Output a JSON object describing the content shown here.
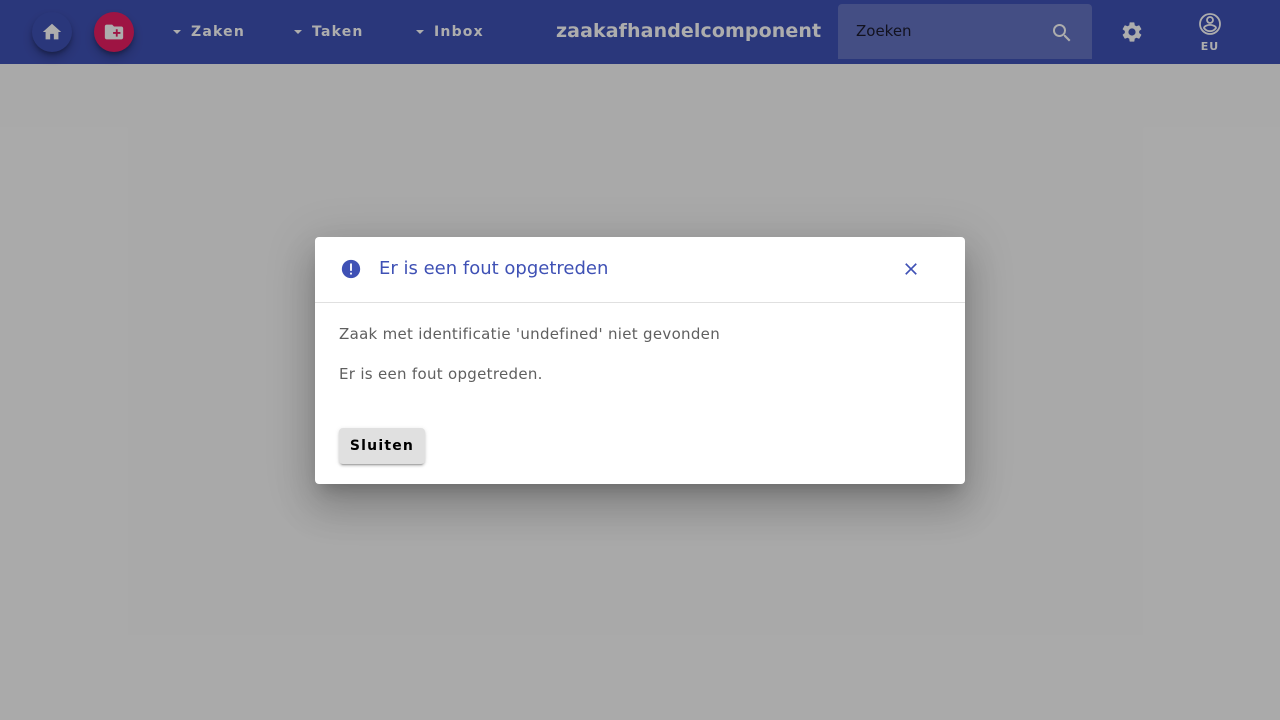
{
  "toolbar": {
    "home_icon": "home-icon",
    "new_case_icon": "create-new-folder-icon",
    "menus": [
      {
        "label": "Zaken"
      },
      {
        "label": "Taken"
      },
      {
        "label": "Inbox"
      }
    ],
    "app_title": "zaakafhandelcomponent",
    "search": {
      "placeholder": "Zoeken",
      "value": ""
    },
    "settings_icon": "gear-icon",
    "user": {
      "icon": "account-circle-icon",
      "initials": "EU"
    },
    "colors": {
      "primary": "#3f51b5",
      "accent": "#e91e63"
    }
  },
  "dialog": {
    "icon": "error-icon",
    "title": "Er is een fout opgetreden",
    "close_icon": "close-icon",
    "messages": [
      "Zaak met identificatie 'undefined' niet gevonden",
      "Er is een fout opgetreden."
    ],
    "close_button_label": "Sluiten"
  }
}
